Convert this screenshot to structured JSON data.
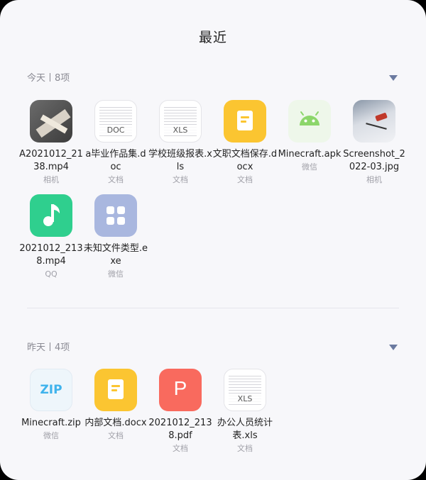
{
  "title": "最近",
  "sections": [
    {
      "label": "今天丨8项",
      "files": [
        {
          "name": "A2021012_2138.mp4",
          "source": "相机",
          "thumb": "photo-thumbnail"
        },
        {
          "name": "a毕业作品集.doc",
          "source": "文档",
          "thumb": "doc-thumbnail",
          "tag": "DOC"
        },
        {
          "name": "学校班级报表.xls",
          "source": "文档",
          "thumb": "xls-thumbnail",
          "tag": "XLS"
        },
        {
          "name": "文职文档保存.docx",
          "source": "文档",
          "thumb": "yellow-doc-icon"
        },
        {
          "name": "Minecraft.apk",
          "source": "微信",
          "thumb": "android-icon"
        },
        {
          "name": "Screenshot_2022-03.jpg",
          "source": "相机",
          "thumb": "skier-photo-thumbnail"
        },
        {
          "name": "2021012_2138.mp4",
          "source": "QQ",
          "thumb": "music-note-icon"
        },
        {
          "name": "未知文件类型.exe",
          "source": "微信",
          "thumb": "unknown-grid-icon"
        }
      ]
    },
    {
      "label": "昨天丨4项",
      "files": [
        {
          "name": "Minecraft.zip",
          "source": "微信",
          "thumb": "zip-icon",
          "tag": "ZIP"
        },
        {
          "name": "内部文档.docx",
          "source": "文档",
          "thumb": "yellow-doc-icon"
        },
        {
          "name": "2021012_2138.pdf",
          "source": "文档",
          "thumb": "pdf-icon",
          "tag": "P"
        },
        {
          "name": "办公人员统计表.xls",
          "source": "文档",
          "thumb": "xls-thumbnail",
          "tag": "XLS"
        }
      ]
    }
  ],
  "colors": {
    "caret": "#6b7aa0",
    "pdf": "#f96a5e",
    "doc_yellow": "#fbc531",
    "music": "#2fcf8e",
    "android": "#8cd66b"
  }
}
